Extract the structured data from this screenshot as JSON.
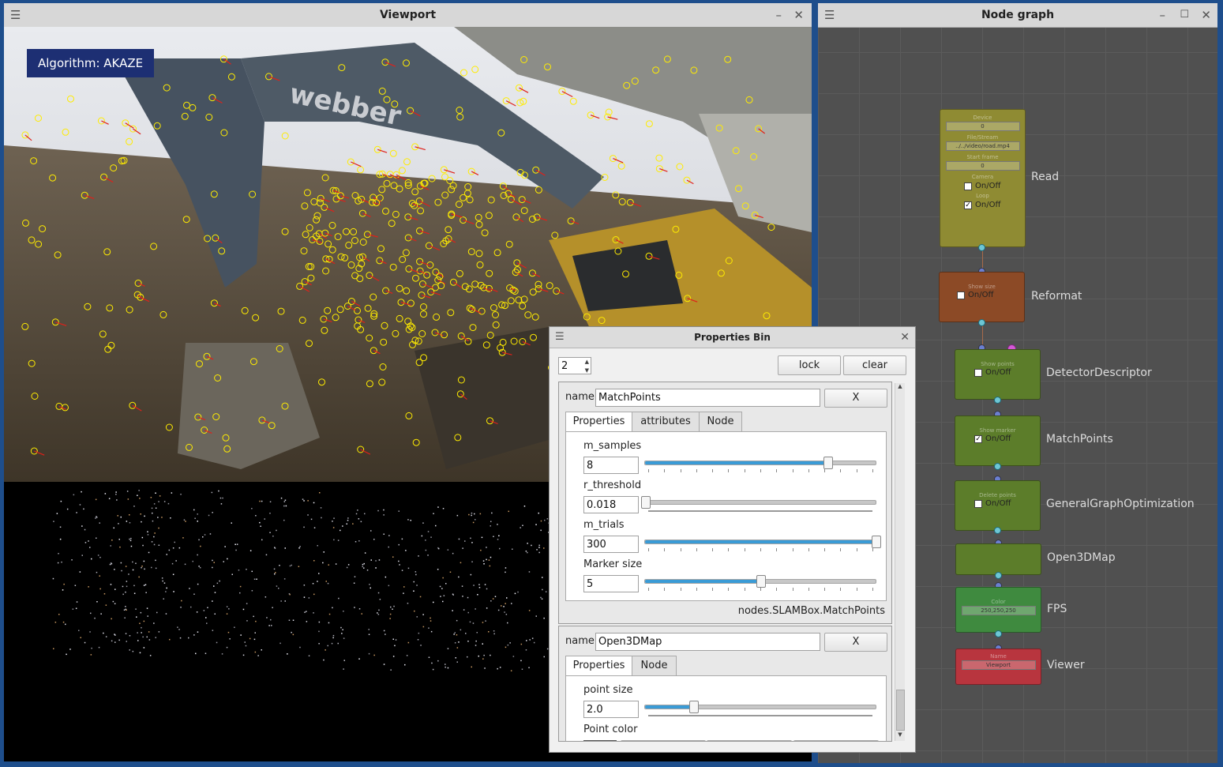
{
  "viewport": {
    "title": "Viewport",
    "overlay": "Algorithm: AKAZE"
  },
  "nodegraph": {
    "title": "Node graph",
    "nodes": [
      {
        "name": "Read",
        "color": "#8f8b33",
        "fields": [
          {
            "label": "Device",
            "value": "0"
          },
          {
            "label": "File/Stream",
            "value": "../../video/road.mp4"
          },
          {
            "label": "Start frame",
            "value": "0"
          }
        ],
        "checks": [
          {
            "label": "Camera",
            "text": "On/Off",
            "checked": false
          },
          {
            "label": "Loop",
            "text": "On/Off",
            "checked": true
          }
        ]
      },
      {
        "name": "Reformat",
        "color": "#8c4a26",
        "checks": [
          {
            "label": "Show size",
            "text": "On/Off",
            "checked": false
          }
        ]
      },
      {
        "name": "DetectorDescriptor",
        "color": "#5c7d2a",
        "checks": [
          {
            "label": "Show points",
            "text": "On/Off",
            "checked": false
          }
        ]
      },
      {
        "name": "MatchPoints",
        "color": "#5c7d2a",
        "checks": [
          {
            "label": "Show marker",
            "text": "On/Off",
            "checked": true
          }
        ]
      },
      {
        "name": "GeneralGraphOptimization",
        "color": "#5c7d2a",
        "checks": [
          {
            "label": "Delete points",
            "text": "On/Off",
            "checked": false
          }
        ]
      },
      {
        "name": "Open3DMap",
        "color": "#5c7d2a"
      },
      {
        "name": "FPS",
        "color": "#3f8a3f",
        "fields": [
          {
            "label": "Color",
            "value": "250,250,250"
          }
        ]
      },
      {
        "name": "Viewer",
        "color": "#b8353e",
        "fields": [
          {
            "label": "Name",
            "value": "Viewport"
          }
        ]
      }
    ]
  },
  "props": {
    "title": "Properties Bin",
    "count": "2",
    "lock_label": "lock",
    "clear_label": "clear",
    "name_label": "name",
    "close_label": "X",
    "panel1": {
      "name": "MatchPoints",
      "tabs": [
        "Properties",
        "attributes",
        "Node"
      ],
      "params": [
        {
          "label": "m_samples",
          "value": "8",
          "fraction": 0.79
        },
        {
          "label": "r_threshold",
          "value": "0.018",
          "fraction": 0.0
        },
        {
          "label": "m_trials",
          "value": "300",
          "fraction": 1.0
        },
        {
          "label": "Marker size",
          "value": "5",
          "fraction": 0.5
        }
      ],
      "footer": "nodes.SLAMBox.MatchPoints"
    },
    "panel2": {
      "name": "Open3DMap",
      "tabs": [
        "Properties",
        "Node"
      ],
      "params": [
        {
          "label": "point size",
          "value": "2.0",
          "fraction": 0.21
        }
      ],
      "color_label": "Point color"
    }
  }
}
